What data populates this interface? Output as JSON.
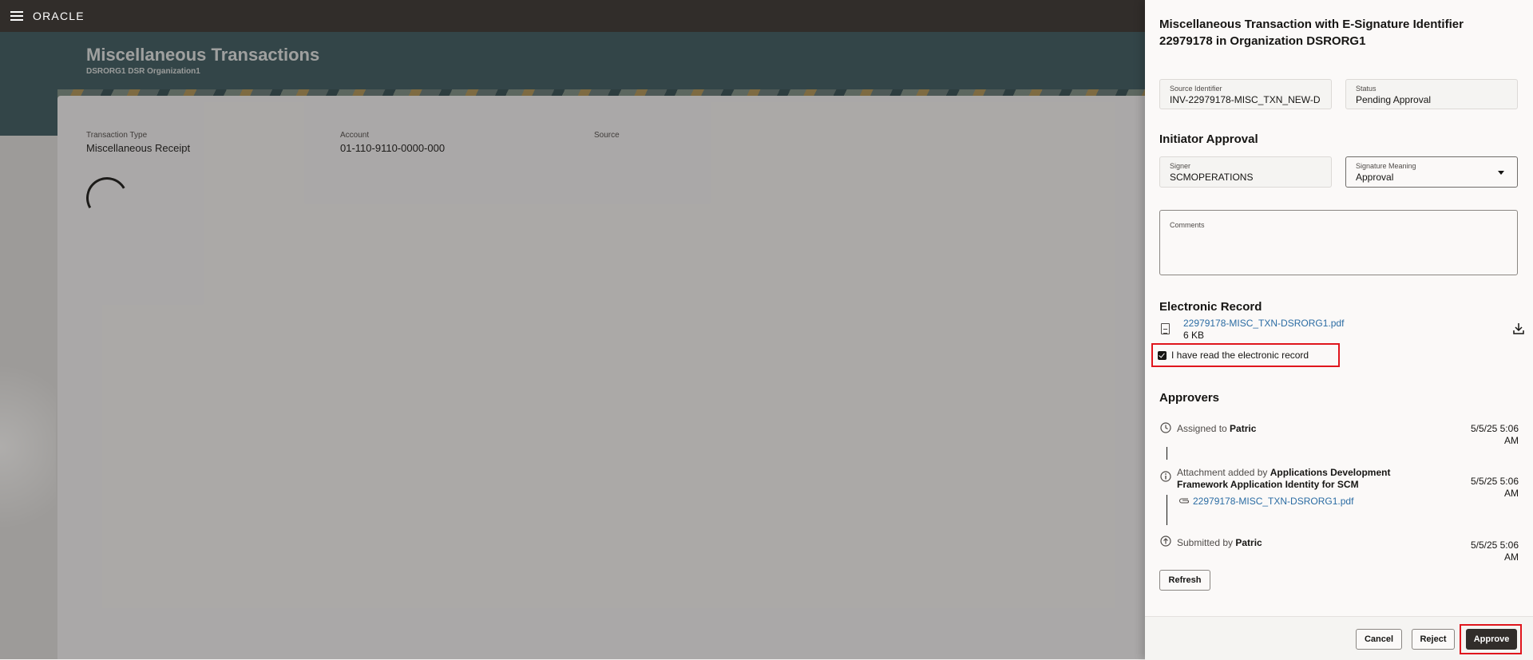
{
  "header": {
    "logo": "ORACLE"
  },
  "page": {
    "title": "Miscellaneous Transactions",
    "subtitle": "DSRORG1 DSR Organization1",
    "fields": [
      {
        "label": "Transaction Type",
        "value": "Miscellaneous Receipt"
      },
      {
        "label": "Account",
        "value": "01-110-9110-0000-000"
      },
      {
        "label": "Source",
        "value": ""
      }
    ]
  },
  "drawer": {
    "title": "Miscellaneous Transaction with E-Signature Identifier 22979178 in Organization DSRORG1",
    "source_identifier": {
      "label": "Source Identifier",
      "value": "INV-22979178-MISC_TXN_NEW-D"
    },
    "status": {
      "label": "Status",
      "value": "Pending Approval"
    },
    "initiator_heading": "Initiator Approval",
    "signer": {
      "label": "Signer",
      "value": "SCMOPERATIONS"
    },
    "signature_meaning": {
      "label": "Signature Meaning",
      "value": "Approval"
    },
    "comments": {
      "label": "Comments",
      "value": ""
    },
    "electronic_record_heading": "Electronic Record",
    "file": {
      "name": "22979178-MISC_TXN-DSRORG1.pdf",
      "size": "6 KB"
    },
    "read_checkbox": {
      "label": "I have read the electronic record",
      "checked": true
    },
    "approvers_heading": "Approvers",
    "approvers": [
      {
        "prefix": "Assigned to ",
        "name": "Patric",
        "time": "5/5/25 5:06 AM",
        "icon": "clock-icon"
      },
      {
        "prefix": "Attachment added by ",
        "name": "Applications Development Framework Application Identity for SCM",
        "time": "5/5/25 5:06 AM",
        "icon": "info-icon",
        "attachment": "22979178-MISC_TXN-DSRORG1.pdf"
      },
      {
        "prefix": "Submitted by ",
        "name": "Patric",
        "time": "5/5/25 5:06 AM",
        "icon": "arrow-up-circle-icon"
      }
    ],
    "refresh_label": "Refresh",
    "buttons": {
      "cancel": "Cancel",
      "reject": "Reject",
      "approve": "Approve"
    }
  },
  "colors": {
    "header_bg": "#312d2a",
    "hero_bg": "#3b5a5e",
    "link": "#2b6ca3",
    "highlight": "#e0161d",
    "primary_button": "#312d2a"
  }
}
